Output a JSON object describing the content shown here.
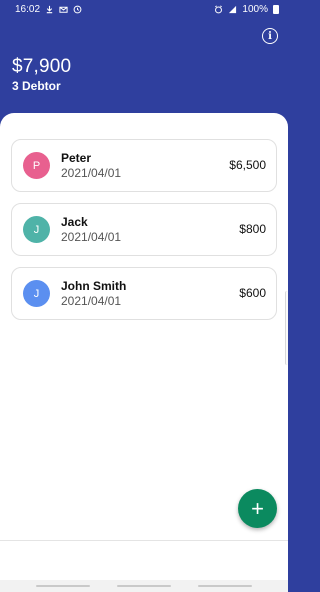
{
  "status_bar": {
    "time": "16:02",
    "battery": "100%",
    "left_icons": [
      "download-icon",
      "mail-icon",
      "clock-icon"
    ],
    "right_icons": [
      "alarm-icon",
      "signal-icon",
      "battery-icon"
    ]
  },
  "header": {
    "total": "$7,900",
    "debtor_count": "3 Debtor",
    "info_icon": "i"
  },
  "debtors": [
    {
      "initial": "P",
      "name": "Peter",
      "date": "2021/04/01",
      "amount": "$6,500",
      "avatar_color": "#e8608f"
    },
    {
      "initial": "J",
      "name": "Jack",
      "date": "2021/04/01",
      "amount": "$800",
      "avatar_color": "#4fb3a8"
    },
    {
      "initial": "J",
      "name": "John Smith",
      "date": "2021/04/01",
      "amount": "$600",
      "avatar_color": "#5b8ff0"
    }
  ],
  "fab": {
    "label": "+"
  },
  "colors": {
    "header_bg": "#2f3f9e",
    "fab_bg": "#0b8a5f"
  }
}
